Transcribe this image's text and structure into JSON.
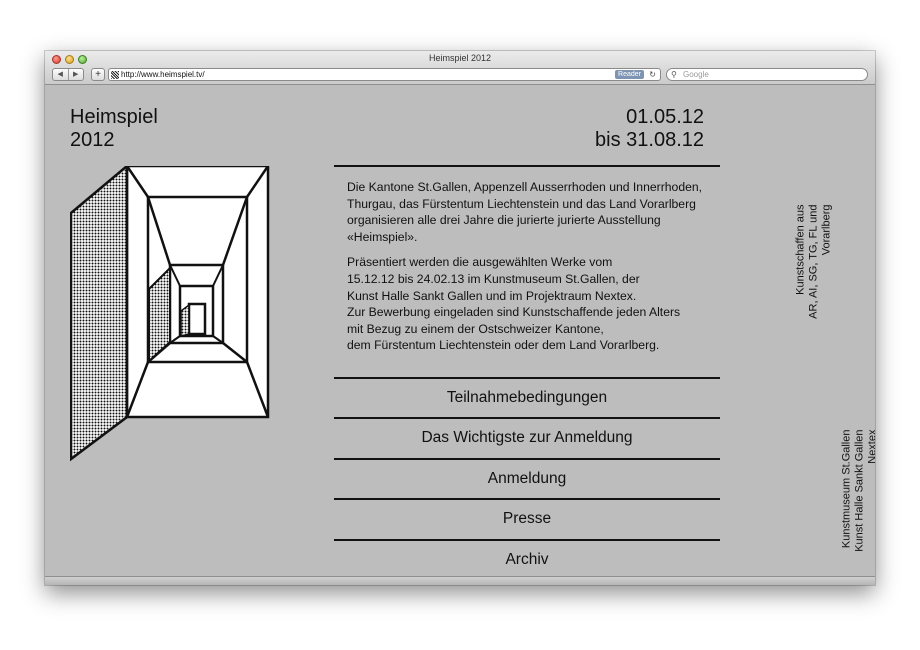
{
  "window": {
    "title": "Heimspiel 2012",
    "url": "http://www.heimspiel.tv/",
    "reader_label": "Reader",
    "search_placeholder": "Google",
    "nav_back": "◀",
    "nav_forward": "▶",
    "add_label": "+",
    "reload_icon": "refresh-icon"
  },
  "site": {
    "title_line1": "Heimspiel",
    "title_line2": "2012",
    "date_line1": "01.05.12",
    "date_line2": "bis 31.08.12"
  },
  "intro": {
    "paragraph1": "Die Kantone St.Gallen, Appenzell Ausserrhoden und Innerrhoden, Thurgau, das Fürstentum Liechtenstein und das Land Vorarlberg organisieren alle drei Jahre die jurierte jurierte Ausstellung «Heimspiel».",
    "paragraph2_line1": "Präsentiert werden die ausgewählten Werke vom",
    "paragraph2_line2": "15.12.12 bis 24.02.13 im Kunstmuseum St.Gallen, der",
    "paragraph2_line3": "Kunst Halle Sankt Gallen und im Projektraum Nextex.",
    "paragraph2_line4": "Zur Bewerbung eingeladen sind Kunstschaffende jeden Alters",
    "paragraph2_line5": "mit Bezug zu einem der Ostschweizer Kantone,",
    "paragraph2_line6": "dem Fürstentum Liechtenstein oder dem Land Vorarlberg."
  },
  "nav": [
    {
      "label": "Teilnahmebedingungen"
    },
    {
      "label": "Das Wichtigste zur Anmeldung"
    },
    {
      "label": "Anmeldung"
    },
    {
      "label": "Presse"
    },
    {
      "label": "Archiv"
    }
  ],
  "sidebar": {
    "vertical1_line1": "Kunstschaffen aus",
    "vertical1_line2": "AR, AI, SG, TG, FL und",
    "vertical1_line3": "Vorarlberg",
    "vertical2_line1": "Kunstmuseum St.Gallen",
    "vertical2_line2": "Kunst Halle Sankt Gallen",
    "vertical2_line3": "Nextex"
  },
  "colors": {
    "background": "#bdbdbd",
    "ink": "#111111"
  }
}
